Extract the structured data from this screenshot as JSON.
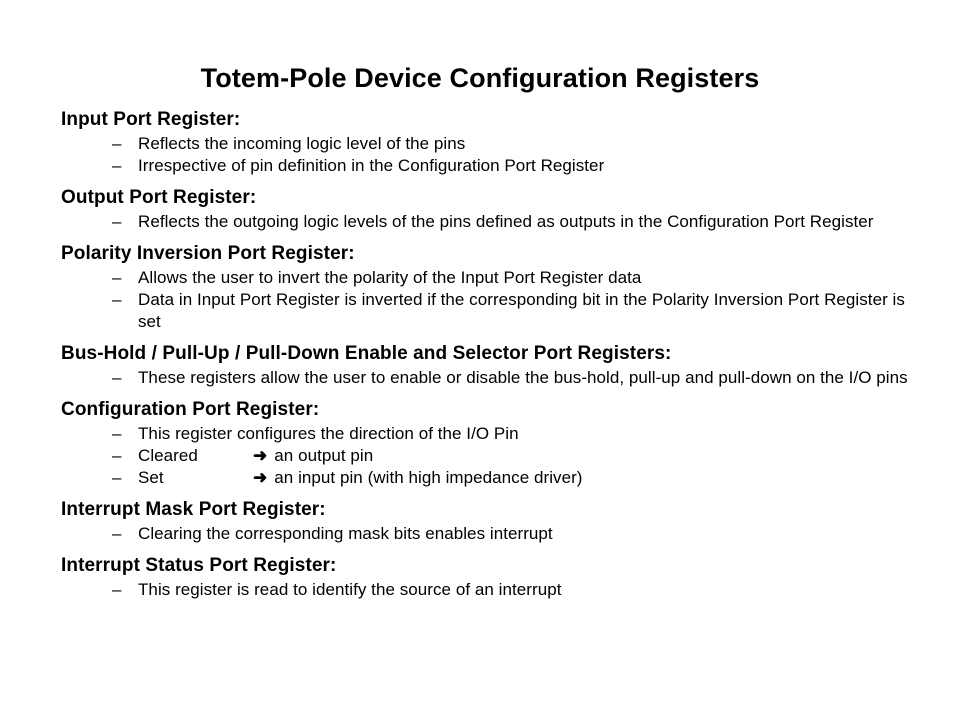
{
  "slide": {
    "title": "Totem-Pole Device Configuration Registers",
    "background_color": "#ffffff",
    "text_color": "#000000",
    "bullet_marker": "–",
    "arrow_glyph": "➜",
    "sections": [
      {
        "heading": "Input Port Register:",
        "bullets": [
          {
            "text": "Reflects the incoming logic level of the pins"
          },
          {
            "text": "Irrespective of pin definition in the Configuration Port Register"
          }
        ]
      },
      {
        "heading": "Output Port Register:",
        "bullets": [
          {
            "text": "Reflects the outgoing logic levels of the pins defined as outputs in the Configuration Port Register"
          }
        ]
      },
      {
        "heading": "Polarity Inversion Port Register:",
        "bullets": [
          {
            "text": "Allows the user to invert the polarity of the Input Port Register data"
          },
          {
            "text": "Data in Input Port Register is inverted if the corresponding bit in the Polarity Inversion Port Register is set"
          }
        ]
      },
      {
        "heading": "Bus-Hold / Pull-Up / Pull-Down Enable and Selector Port Registers:",
        "bullets": [
          {
            "text": "These registers allow the user to enable or disable the bus-hold, pull-up and pull-down  on the I/O pins"
          }
        ]
      },
      {
        "heading": "Configuration Port Register:",
        "bullets": [
          {
            "text": "This register configures the direction of the I/O Pin"
          },
          {
            "label": "Cleared",
            "arrow": "➜",
            "text": "an output pin"
          },
          {
            "label": "Set",
            "arrow": "➜",
            "text": "an input pin (with high impedance driver)"
          }
        ]
      },
      {
        "heading": "Interrupt Mask Port Register:",
        "bullets": [
          {
            "text": "Clearing the corresponding mask bits enables interrupt"
          }
        ]
      },
      {
        "heading": "Interrupt Status Port Register:",
        "bullets": [
          {
            "text": "This register is read to identify the source of an interrupt"
          }
        ]
      }
    ]
  }
}
